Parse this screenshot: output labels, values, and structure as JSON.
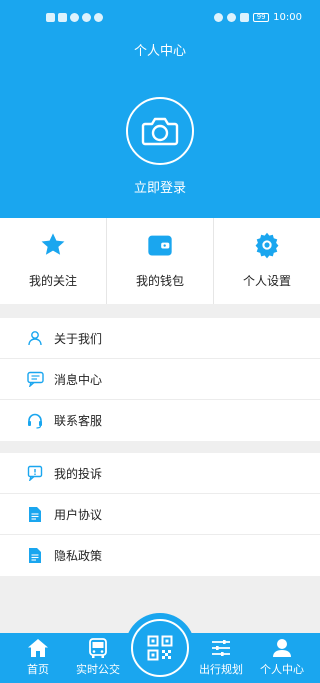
{
  "status_bar": {
    "time": "10:00",
    "battery": "99"
  },
  "header": {
    "title": "个人中心",
    "login_label": "立即登录"
  },
  "quick_actions": [
    {
      "label": "我的关注",
      "icon": "star-icon"
    },
    {
      "label": "我的钱包",
      "icon": "wallet-icon"
    },
    {
      "label": "个人设置",
      "icon": "gear-icon"
    }
  ],
  "menu_group1": [
    {
      "label": "关于我们",
      "icon": "person-icon"
    },
    {
      "label": "消息中心",
      "icon": "chat-icon"
    },
    {
      "label": "联系客服",
      "icon": "headset-icon"
    }
  ],
  "menu_group2": [
    {
      "label": "我的投诉",
      "icon": "complaint-icon"
    },
    {
      "label": "用户协议",
      "icon": "document-icon"
    },
    {
      "label": "隐私政策",
      "icon": "document-icon"
    }
  ],
  "bottom_nav": {
    "home": "首页",
    "realtime_bus": "实时公交",
    "trip_planning": "出行规划",
    "profile": "个人中心"
  },
  "colors": {
    "accent": "#1aa6ef",
    "background": "#efefef"
  }
}
